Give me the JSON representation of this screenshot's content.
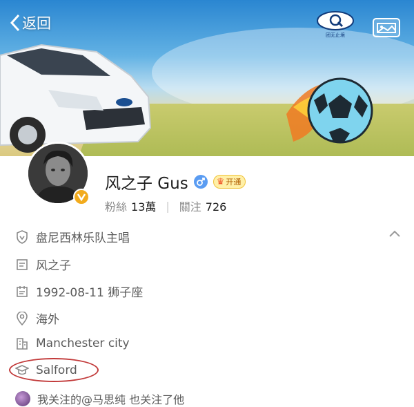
{
  "nav": {
    "back_label": "返回",
    "brand_logo_text": "团无止境"
  },
  "profile": {
    "name": "风之子 Gus",
    "gender_icon": "male-icon",
    "vip_label": "开通",
    "fans_label": "粉絲",
    "fans_count": "13萬",
    "following_label": "關注",
    "following_count": "726"
  },
  "details": [
    {
      "icon": "verified-shield-icon",
      "text": "盘尼西林乐队主唱"
    },
    {
      "icon": "profile-card-icon",
      "text": "风之子"
    },
    {
      "icon": "calendar-icon",
      "text": "1992-08-11 狮子座"
    },
    {
      "icon": "location-pin-icon",
      "text": "海外"
    },
    {
      "icon": "company-building-icon",
      "text": "Manchester city"
    },
    {
      "icon": "graduation-cap-icon",
      "text": "Salford"
    }
  ],
  "mutual": {
    "text": "我关注的@马思纯 也关注了他"
  },
  "colors": {
    "accent_orange": "#f2ab1d",
    "gender_blue": "#5a9cf2",
    "highlight_red": "#c23a3a"
  }
}
